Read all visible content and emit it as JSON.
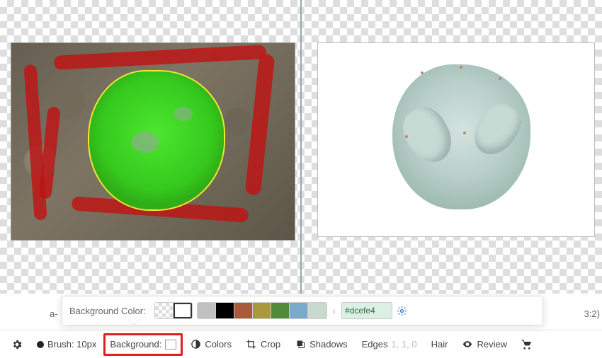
{
  "popup": {
    "label": "Background Color:",
    "swatches_left": [
      {
        "name": "swatch-transparent",
        "css": "none"
      },
      {
        "name": "swatch-white",
        "color": "#ffffff"
      }
    ],
    "swatches_main": [
      {
        "name": "swatch-gray",
        "color": "#c0c0c0"
      },
      {
        "name": "swatch-black",
        "color": "#000000"
      },
      {
        "name": "swatch-brown",
        "color": "#a85a3a"
      },
      {
        "name": "swatch-olive",
        "color": "#a89a3c"
      },
      {
        "name": "swatch-green",
        "color": "#4f8b3b"
      },
      {
        "name": "swatch-blue",
        "color": "#7ba9c9"
      },
      {
        "name": "swatch-sage",
        "color": "#c9d9cf"
      }
    ],
    "hex_value": "#dcefe4"
  },
  "toolbar": {
    "brush_label": "Brush: 10px",
    "background_label": "Background:",
    "colors_label": "Colors",
    "crop_label": "Crop",
    "shadows_label": "Shadows",
    "edges_label": "Edges",
    "edges_values": "1, 1, 0",
    "hair_label": "Hair",
    "review_label": "Review"
  },
  "ratio_text": "3:2)",
  "prefix_text": "a-"
}
